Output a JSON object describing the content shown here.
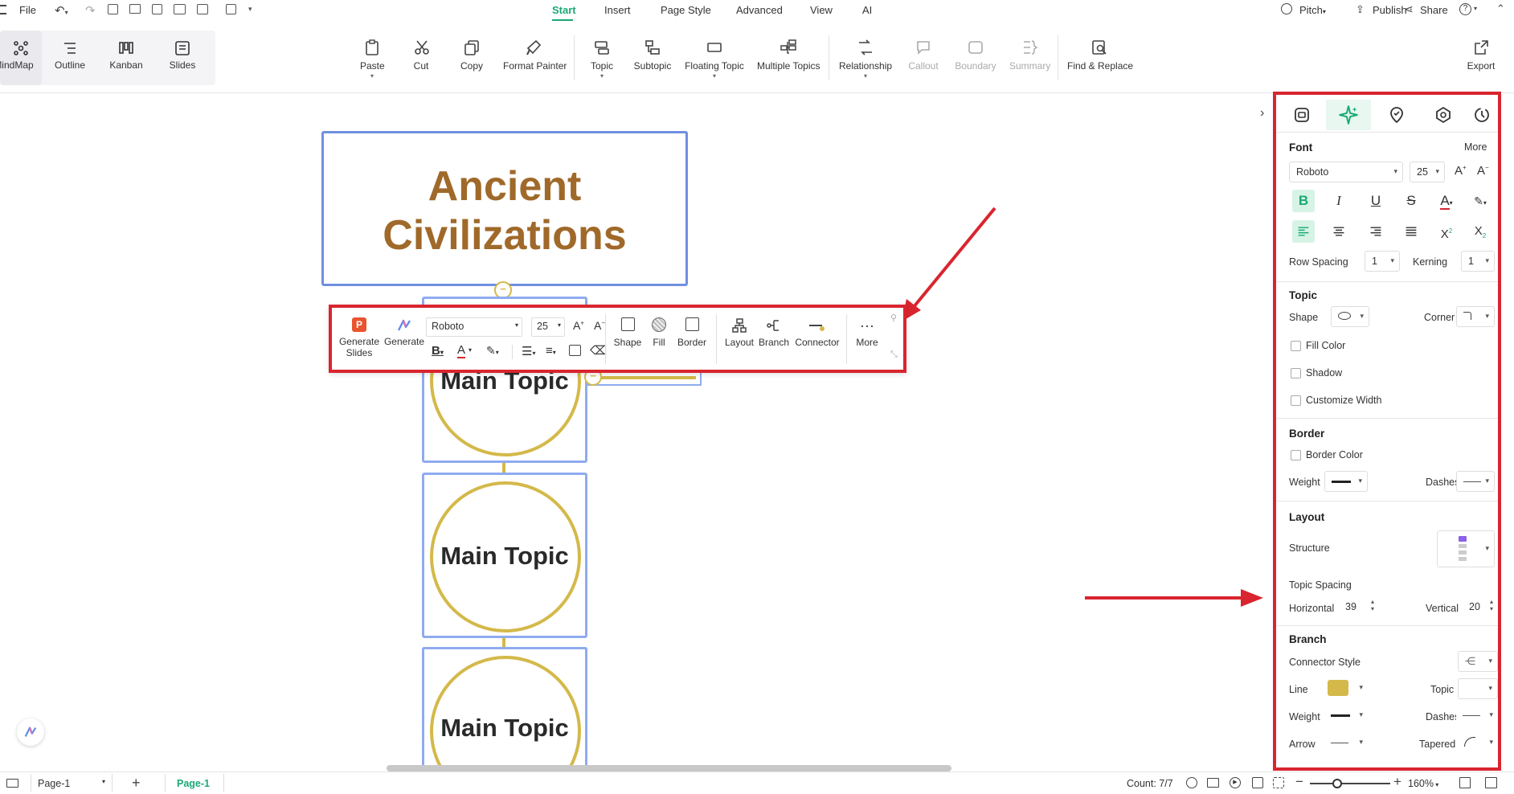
{
  "menu": {
    "file": "File",
    "tabs": [
      "Start",
      "Insert",
      "Page Style",
      "Advanced",
      "View",
      "AI"
    ],
    "pitch": "Pitch",
    "publish": "Publish",
    "share": "Share"
  },
  "views": [
    "MindMap",
    "Outline",
    "Kanban",
    "Slides"
  ],
  "ribbon": {
    "paste": "Paste",
    "cut": "Cut",
    "copy": "Copy",
    "format_painter": "Format Painter",
    "topic": "Topic",
    "subtopic": "Subtopic",
    "floating_topic": "Floating Topic",
    "multiple_topics": "Multiple Topics",
    "relationship": "Relationship",
    "callout": "Callout",
    "boundary": "Boundary",
    "summary": "Summary",
    "find_replace": "Find & Replace",
    "export": "Export"
  },
  "canvas": {
    "central_topic": "Ancient\nCivilizations",
    "central_line1": "Ancient",
    "central_line2": "Civilizations",
    "main_topics": [
      "Main Topic",
      "Main Topic",
      "Main Topic"
    ],
    "colors": {
      "title": "#a0692a",
      "frame": "#6f8fe0",
      "gold": "#d4b94a"
    }
  },
  "floating_toolbar": {
    "generate_slides": "Generate\nSlides",
    "generate": "Generate",
    "font": "Roboto",
    "size": "25",
    "shape": "Shape",
    "fill": "Fill",
    "border": "Border",
    "layout": "Layout",
    "branch": "Branch",
    "connector": "Connector",
    "more": "More"
  },
  "panel": {
    "font_title": "Font",
    "more": "More",
    "font_family": "Roboto",
    "font_size": "25",
    "row_spacing_label": "Row Spacing",
    "row_spacing": "1",
    "kerning_label": "Kerning",
    "kerning": "1",
    "topic_title": "Topic",
    "shape_label": "Shape",
    "corner_label": "Corner",
    "fill_color": "Fill Color",
    "shadow": "Shadow",
    "customize_width": "Customize Width",
    "border_title": "Border",
    "border_color": "Border Color",
    "weight_label": "Weight",
    "dashes_label": "Dashes",
    "layout_title": "Layout",
    "structure_label": "Structure",
    "topic_spacing": "Topic Spacing",
    "horizontal_label": "Horizontal",
    "horizontal": "39",
    "vertical_label": "Vertical",
    "vertical": "20",
    "branch_title": "Branch",
    "connector_style": "Connector Style",
    "line_label": "Line",
    "line_color": "#d4b94a",
    "topic_label": "Topic",
    "weight2_label": "Weight",
    "dashes2_label": "Dashes",
    "arrow_label": "Arrow",
    "tapered_label": "Tapered"
  },
  "status": {
    "page_tab": "Page-1",
    "active_page": "Page-1",
    "count": "Count: 7/7",
    "zoom": "160%"
  },
  "accent": "#19a974",
  "highlight": "#d9252f"
}
